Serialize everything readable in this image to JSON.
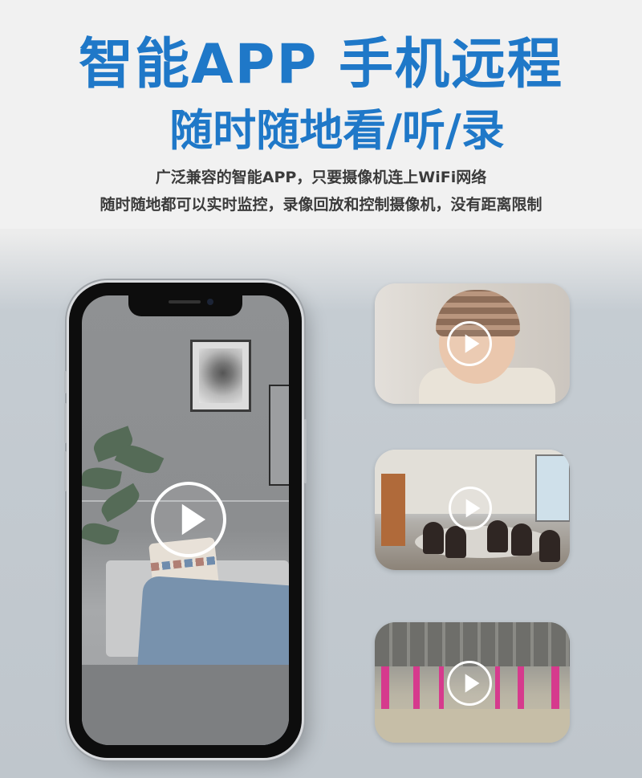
{
  "header": {
    "title_line1": "智能APP 手机远程",
    "title_line2": "随时随地看/听/录",
    "desc_line1": "广泛兼容的智能APP，只要摄像机连上WiFi网络",
    "desc_line2": "随时随地都可以实时监控，录像回放和控制摄像机，没有距离限制"
  },
  "colors": {
    "title_blue": "#1f78c8",
    "desc_gray": "#3b3b3b",
    "header_bg": "#f1f1f1",
    "lower_bg": "#c5ccd2",
    "accent_pink": "#d63a8d"
  },
  "phone": {
    "scene": "living-room",
    "icon": "play-icon"
  },
  "thumbnails": [
    {
      "scene": "baby",
      "icon": "play-icon"
    },
    {
      "scene": "office-meeting",
      "icon": "play-icon"
    },
    {
      "scene": "parking-garage",
      "icon": "play-icon"
    }
  ]
}
